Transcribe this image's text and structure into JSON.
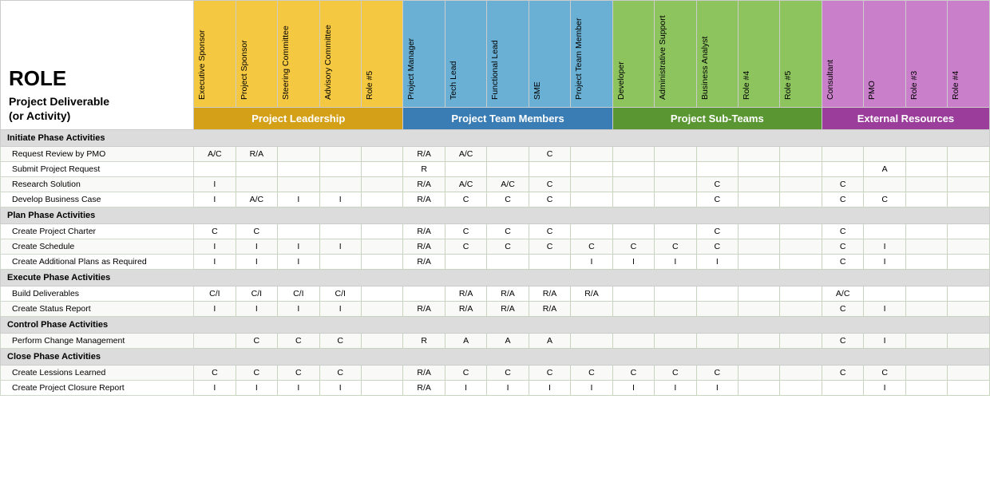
{
  "title": "ROLE",
  "subtitle": "Project Deliverable\n(or Activity)",
  "groups": [
    {
      "label": "Project Leadership",
      "span": 5,
      "colorClass": "gh-leadership",
      "headerBg": "bg-leadership",
      "colBg": "col-leadership"
    },
    {
      "label": "Project Team Members",
      "span": 5,
      "colorClass": "gh-team",
      "headerBg": "bg-team",
      "colBg": "col-team"
    },
    {
      "label": "Project Sub-Teams",
      "span": 6,
      "colorClass": "gh-subteam",
      "headerBg": "bg-subteam",
      "colBg": "col-subteam"
    },
    {
      "label": "External Resources",
      "span": 4,
      "colorClass": "gh-external",
      "headerBg": "bg-external",
      "colBg": "col-external"
    }
  ],
  "columns": [
    {
      "label": "Executive Sponsor",
      "group": 0
    },
    {
      "label": "Project Sponsor",
      "group": 0
    },
    {
      "label": "Steering Committee",
      "group": 0
    },
    {
      "label": "Advisory Committee",
      "group": 0
    },
    {
      "label": "Role #5",
      "group": 0
    },
    {
      "label": "Project Manager",
      "group": 1
    },
    {
      "label": "Tech Lead",
      "group": 1
    },
    {
      "label": "Functional Lead",
      "group": 1
    },
    {
      "label": "SME",
      "group": 1
    },
    {
      "label": "Project Team Member",
      "group": 1
    },
    {
      "label": "Developer",
      "group": 2
    },
    {
      "label": "Administrative Support",
      "group": 2
    },
    {
      "label": "Business Analyst",
      "group": 2
    },
    {
      "label": "Role #4",
      "group": 2
    },
    {
      "label": "Role #5",
      "group": 2
    },
    {
      "label": "Consultant",
      "group": 3
    },
    {
      "label": "PMO",
      "group": 3
    },
    {
      "label": "Role #3",
      "group": 3
    },
    {
      "label": "Role #4",
      "group": 3
    }
  ],
  "rows": [
    {
      "type": "phase",
      "label": "Initiate Phase Activities",
      "values": [
        "",
        "",
        "",
        "",
        "",
        "",
        "",
        "",
        "",
        "",
        "",
        "",
        "",
        "",
        "",
        "",
        "",
        "",
        ""
      ]
    },
    {
      "type": "data",
      "label": "Request Review by PMO",
      "values": [
        "A/C",
        "R/A",
        "",
        "",
        "",
        "R/A",
        "A/C",
        "",
        "C",
        "",
        "",
        "",
        "",
        "",
        "",
        "",
        "",
        "",
        ""
      ]
    },
    {
      "type": "data",
      "label": "Submit Project Request",
      "values": [
        "",
        "",
        "",
        "",
        "",
        "R",
        "",
        "",
        "",
        "",
        "",
        "",
        "",
        "",
        "",
        "",
        "A",
        "",
        ""
      ]
    },
    {
      "type": "data",
      "label": "Research Solution",
      "values": [
        "I",
        "",
        "",
        "",
        "",
        "R/A",
        "A/C",
        "A/C",
        "C",
        "",
        "",
        "",
        "C",
        "",
        "",
        "C",
        "",
        "",
        ""
      ]
    },
    {
      "type": "data",
      "label": "Develop Business Case",
      "values": [
        "I",
        "A/C",
        "I",
        "I",
        "",
        "R/A",
        "C",
        "C",
        "C",
        "",
        "",
        "",
        "C",
        "",
        "",
        "C",
        "C",
        "",
        ""
      ]
    },
    {
      "type": "phase",
      "label": "Plan Phase Activities",
      "values": [
        "",
        "",
        "",
        "",
        "",
        "",
        "",
        "",
        "",
        "",
        "",
        "",
        "",
        "",
        "",
        "",
        "",
        "",
        ""
      ]
    },
    {
      "type": "data",
      "label": "Create Project Charter",
      "values": [
        "C",
        "C",
        "",
        "",
        "",
        "R/A",
        "C",
        "C",
        "C",
        "",
        "",
        "",
        "C",
        "",
        "",
        "C",
        "",
        "",
        ""
      ]
    },
    {
      "type": "data",
      "label": "Create Schedule",
      "values": [
        "I",
        "I",
        "I",
        "I",
        "",
        "R/A",
        "C",
        "C",
        "C",
        "C",
        "C",
        "C",
        "C",
        "",
        "",
        "C",
        "I",
        "",
        ""
      ]
    },
    {
      "type": "data",
      "label": "Create Additional Plans as Required",
      "values": [
        "I",
        "I",
        "I",
        "",
        "",
        "R/A",
        "",
        "",
        "",
        "I",
        "I",
        "I",
        "I",
        "",
        "",
        "C",
        "I",
        "",
        ""
      ]
    },
    {
      "type": "phase",
      "label": "Execute Phase Activities",
      "values": [
        "",
        "",
        "",
        "",
        "",
        "",
        "",
        "",
        "",
        "",
        "",
        "",
        "",
        "",
        "",
        "",
        "",
        "",
        ""
      ]
    },
    {
      "type": "data",
      "label": "Build Deliverables",
      "values": [
        "C/I",
        "C/I",
        "C/I",
        "C/I",
        "",
        "",
        "R/A",
        "R/A",
        "R/A",
        "R/A",
        "",
        "",
        "",
        "",
        "",
        "A/C",
        "",
        "",
        ""
      ]
    },
    {
      "type": "data",
      "label": "Create Status Report",
      "values": [
        "I",
        "I",
        "I",
        "I",
        "",
        "R/A",
        "R/A",
        "R/A",
        "R/A",
        "",
        "",
        "",
        "",
        "",
        "",
        "C",
        "I",
        "",
        ""
      ]
    },
    {
      "type": "phase",
      "label": "Control Phase Activities",
      "values": [
        "",
        "",
        "",
        "",
        "",
        "",
        "",
        "",
        "",
        "",
        "",
        "",
        "",
        "",
        "",
        "",
        "",
        "",
        ""
      ]
    },
    {
      "type": "data",
      "label": "Perform Change Management",
      "values": [
        "",
        "C",
        "C",
        "C",
        "",
        "R",
        "A",
        "A",
        "A",
        "",
        "",
        "",
        "",
        "",
        "",
        "C",
        "I",
        "",
        ""
      ]
    },
    {
      "type": "phase",
      "label": "Close Phase Activities",
      "values": [
        "",
        "",
        "",
        "",
        "",
        "",
        "",
        "",
        "",
        "",
        "",
        "",
        "",
        "",
        "",
        "",
        "",
        "",
        ""
      ]
    },
    {
      "type": "data",
      "label": "Create Lessions Learned",
      "values": [
        "C",
        "C",
        "C",
        "C",
        "",
        "R/A",
        "C",
        "C",
        "C",
        "C",
        "C",
        "C",
        "C",
        "",
        "",
        "C",
        "C",
        "",
        ""
      ]
    },
    {
      "type": "data",
      "label": "Create Project Closure Report",
      "values": [
        "I",
        "I",
        "I",
        "I",
        "",
        "R/A",
        "I",
        "I",
        "I",
        "I",
        "I",
        "I",
        "I",
        "",
        "",
        "",
        "I",
        "",
        ""
      ]
    }
  ]
}
